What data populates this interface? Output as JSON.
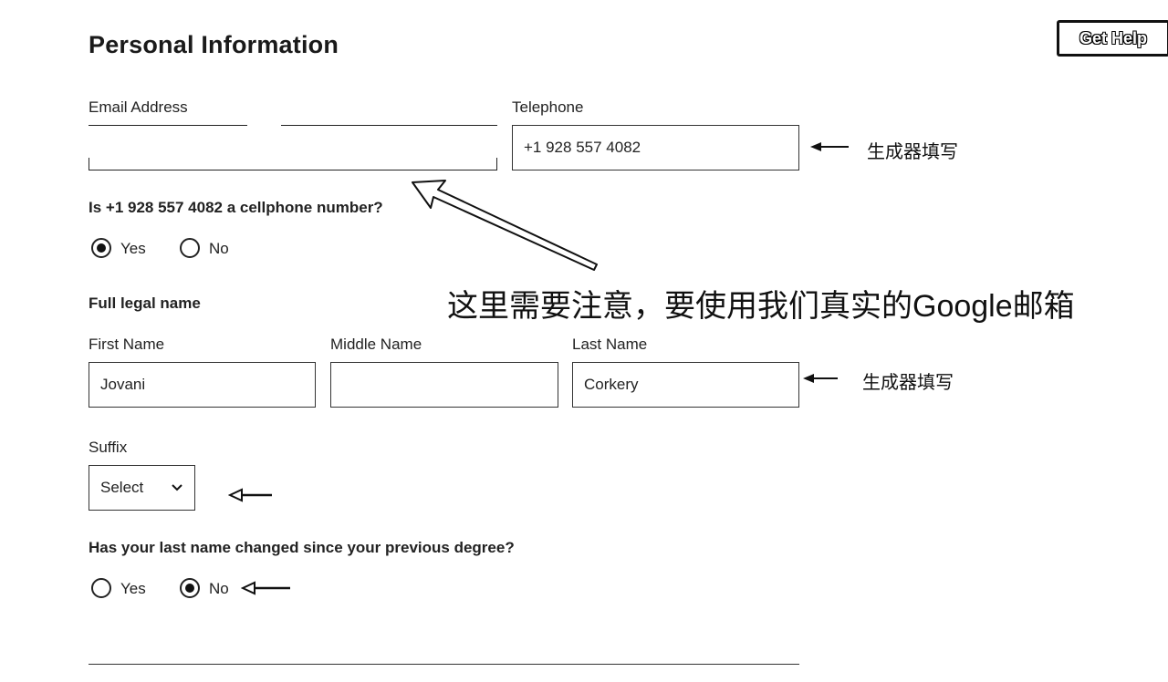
{
  "header": {
    "title": "Personal Information",
    "help_label": "Get Help"
  },
  "contact": {
    "email_label": "Email Address",
    "email_value": "",
    "telephone_label": "Telephone",
    "telephone_value": "+1 928 557 4082"
  },
  "cellphone_question": {
    "text": "Is +1 928 557 4082 a cellphone number?",
    "options": [
      {
        "label": "Yes",
        "selected": true
      },
      {
        "label": "No",
        "selected": false
      }
    ]
  },
  "name": {
    "section_label": "Full legal name",
    "first_label": "First Name",
    "first_value": "Jovani",
    "middle_label": "Middle Name",
    "middle_value": "",
    "last_label": "Last Name",
    "last_value": "Corkery",
    "suffix_label": "Suffix",
    "suffix_value": "Select"
  },
  "name_change_question": {
    "text": "Has your last name changed since your previous degree?",
    "options": [
      {
        "label": "Yes",
        "selected": false
      },
      {
        "label": "No",
        "selected": true
      }
    ]
  },
  "annotations": {
    "generator_fill": "生成器填写",
    "email_note": "这里需要注意，要使用我们真实的Google邮箱"
  },
  "icons": {
    "select_caret": "chevron-down-icon",
    "pointer_arrow": "arrow-left-icon"
  }
}
